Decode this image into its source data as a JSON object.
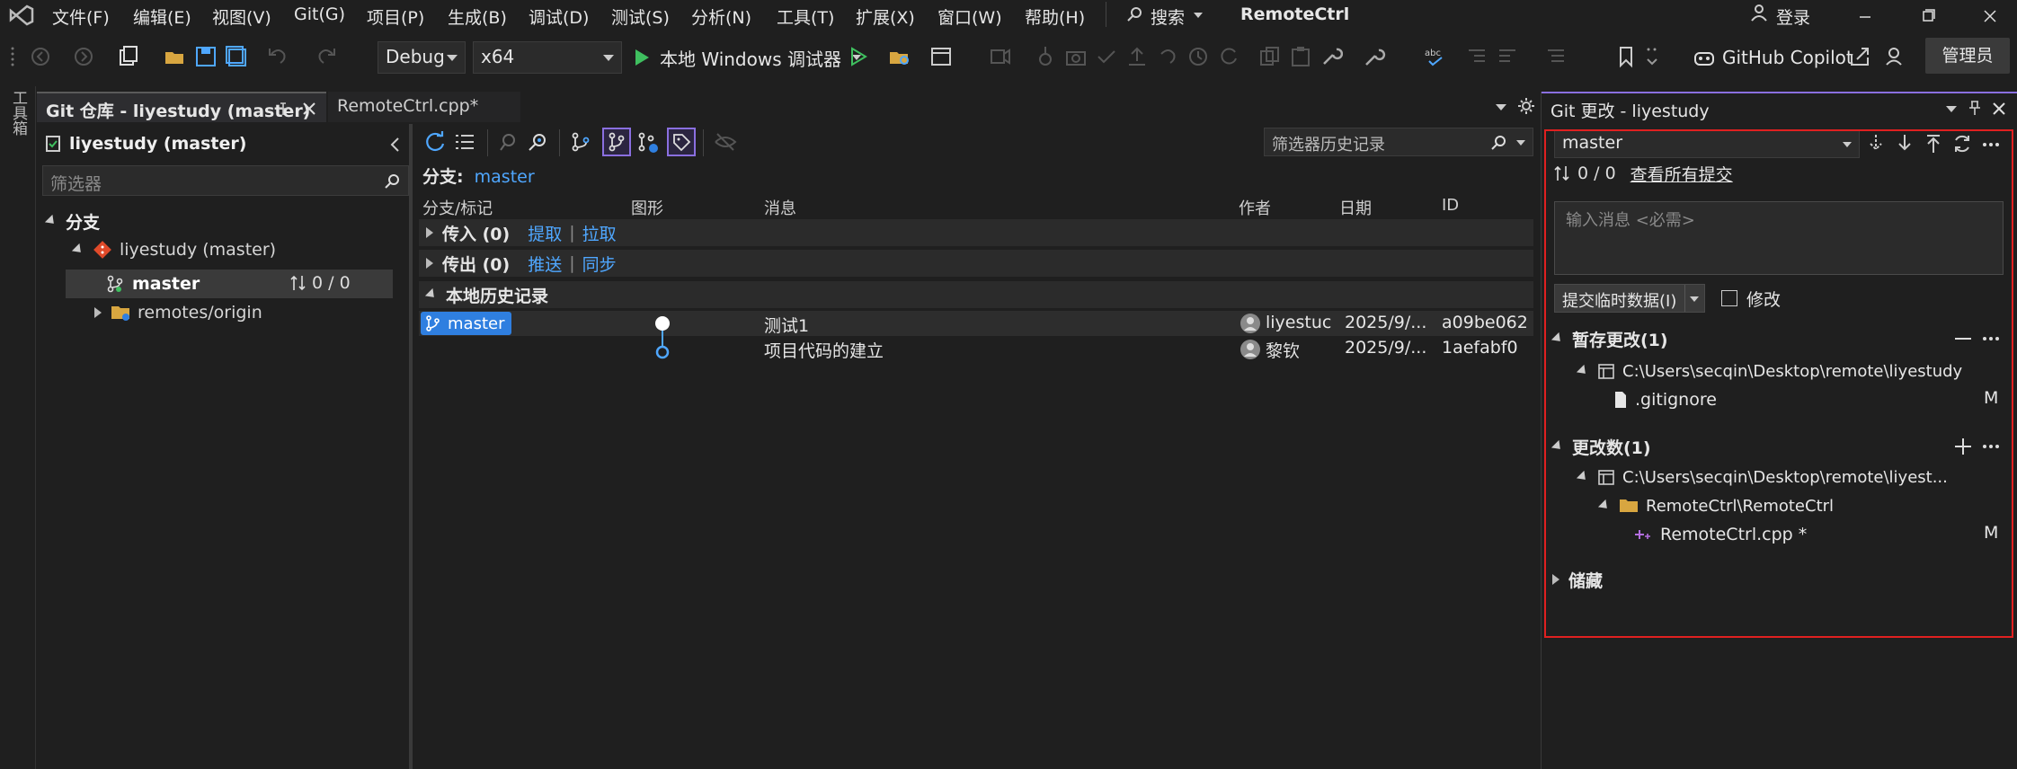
{
  "menubar": {
    "items": [
      "文件(F)",
      "编辑(E)",
      "视图(V)",
      "Git(G)",
      "项目(P)",
      "生成(B)",
      "调试(D)",
      "测试(S)",
      "分析(N)",
      "工具(T)",
      "扩展(X)",
      "窗口(W)",
      "帮助(H)"
    ],
    "search_label": "搜索",
    "solution_title": "RemoteCtrl",
    "login_label": "登录"
  },
  "toolbar": {
    "config_value": "Debug",
    "platform_value": "x64",
    "run_label": "本地 Windows 调试器",
    "copilot_label": "GitHub Copilot",
    "admin_label": "管理员"
  },
  "toolbox": {
    "label": "工具箱"
  },
  "tabs": [
    {
      "label": "Git 仓库 - liyestudy (master)"
    },
    {
      "label": "RemoteCtrl.cpp*"
    }
  ],
  "left_panel": {
    "repo_title": "liyestudy (master)",
    "filter_placeholder": "筛选器",
    "branches_header": "分支",
    "repo_node": "liyestudy (master)",
    "branch_master": "master",
    "branch_master_sync": "0 / 0",
    "remotes_node": "remotes/origin"
  },
  "center_panel": {
    "filter_placeholder": "筛选器历史记录",
    "branch_label": "分支:",
    "branch_value": "master",
    "columns": {
      "branch": "分支/标记",
      "graph": "图形",
      "message": "消息",
      "author": "作者",
      "date": "日期",
      "id": "ID"
    },
    "incoming": {
      "label": "传入 (0)",
      "fetch": "提取",
      "pull": "拉取"
    },
    "outgoing": {
      "label": "传出 (0)",
      "push": "推送",
      "sync": "同步"
    },
    "local_history": {
      "label": "本地历史记录"
    },
    "commits": [
      {
        "tag": "master",
        "message": "测试1",
        "author": "liyestuc",
        "date": "2025/9/...",
        "id": "a09be062"
      },
      {
        "tag": "",
        "message": "项目代码的建立",
        "author": "黎钦",
        "date": "2025/9/...",
        "id": "1aefabf0"
      }
    ]
  },
  "right_panel": {
    "title": "Git 更改 - liyestudy",
    "branch_value": "master",
    "sync_status": "0 / 0",
    "view_all_commits": "查看所有提交",
    "message_placeholder": "输入消息 <必需>",
    "commit_staged_label": "提交临时数据(I)",
    "amend_label": "修改",
    "staged": {
      "header": "暂存更改(1)",
      "path": "C:\\Users\\secqin\\Desktop\\remote\\liyestudy",
      "file": ".gitignore",
      "file_status": "M"
    },
    "changes": {
      "header": "更改数(1)",
      "path": "C:\\Users\\secqin\\Desktop\\remote\\liyest...",
      "folder": "RemoteCtrl\\RemoteCtrl",
      "file": "RemoteCtrl.cpp *",
      "file_status": "M"
    },
    "stash": {
      "header": "储藏"
    }
  },
  "colors": {
    "accent_blue": "#2f7fe0",
    "link_blue": "#4fa7ff",
    "highlight_red": "#e02020",
    "run_green": "#3fbf5f"
  }
}
